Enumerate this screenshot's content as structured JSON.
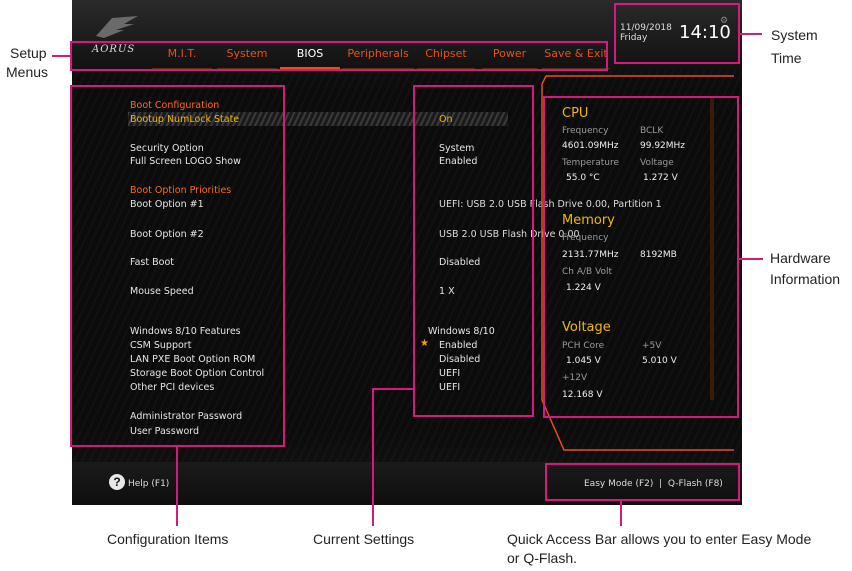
{
  "bios": {
    "logo": "AORUS",
    "menus": [
      {
        "label": "M.I.T."
      },
      {
        "label": "System"
      },
      {
        "label": "BIOS"
      },
      {
        "label": "Peripherals"
      },
      {
        "label": "Chipset"
      },
      {
        "label": "Power"
      },
      {
        "label": "Save & Exit"
      }
    ],
    "active_menu": "BIOS",
    "time": {
      "date": "11/09/2018",
      "day": "Friday",
      "clock": "14:10"
    },
    "config": {
      "boot_configuration": "Boot Configuration",
      "bootup_numlock": "Bootup NumLock State",
      "security_option": "Security Option",
      "full_screen_logo": "Full Screen LOGO Show",
      "boot_option_priorities": "Boot Option Priorities",
      "boot_option_1": "Boot Option #1",
      "boot_option_2": "Boot Option #2",
      "fast_boot": "Fast Boot",
      "mouse_speed": "Mouse Speed",
      "windows_features": "Windows 8/10 Features",
      "csm_support": "CSM Support",
      "lan_pxe": "LAN PXE Boot Option ROM",
      "storage_boot": "Storage Boot Option Control",
      "other_pci": "Other PCI devices",
      "admin_password": "Administrator Password",
      "user_password": "User Password"
    },
    "values": {
      "numlock": "On",
      "security": "System",
      "logo_show": "Enabled",
      "boot1": "UEFI: USB 2.0 USB Flash Drive 0.00, Partition 1",
      "boot2": "USB 2.0 USB Flash Drive 0.00",
      "fast_boot": "Disabled",
      "mouse_speed": "1 X",
      "windows_features": "Windows 8/10",
      "csm": "Enabled",
      "lan_pxe": "Disabled",
      "storage": "UEFI",
      "other_pci": "UEFI"
    },
    "hardware": {
      "cpu": {
        "title": "CPU",
        "freq_label": "Frequency",
        "freq": "4601.09MHz",
        "bclk_label": "BCLK",
        "bclk": "99.92MHz",
        "temp_label": "Temperature",
        "temp": "55.0 °C",
        "volt_label": "Voltage",
        "volt": "1.272 V"
      },
      "memory": {
        "title": "Memory",
        "freq_label": "Frequency",
        "freq": "2131.77MHz",
        "size": "8192MB",
        "ab_label": "Ch A/B Volt",
        "ab": "1.224 V"
      },
      "voltage": {
        "title": "Voltage",
        "pch_label": "PCH Core",
        "pch": "1.045 V",
        "v5_label": "+5V",
        "v5": "5.010 V",
        "v12_label": "+12V",
        "v12": "12.168 V"
      }
    },
    "help": "Help (F1)",
    "quick_access": "Easy Mode (F2)  |  Q-Flash (F8)"
  },
  "callouts": {
    "setup_menus_1": "Setup",
    "setup_menus_2": "Menus",
    "system_time_1": "System",
    "system_time_2": "Time",
    "hardware_1": "Hardware",
    "hardware_2": "Information",
    "config_items": "Configuration Items",
    "current_settings": "Current Settings",
    "quick_access_1": "Quick Access Bar allows you to enter Easy Mode",
    "quick_access_2": "or Q-Flash."
  },
  "colors": {
    "accent_orange": "#e8501b",
    "highlight_yellow": "#f2b705",
    "callout_pink": "#d6197e"
  }
}
